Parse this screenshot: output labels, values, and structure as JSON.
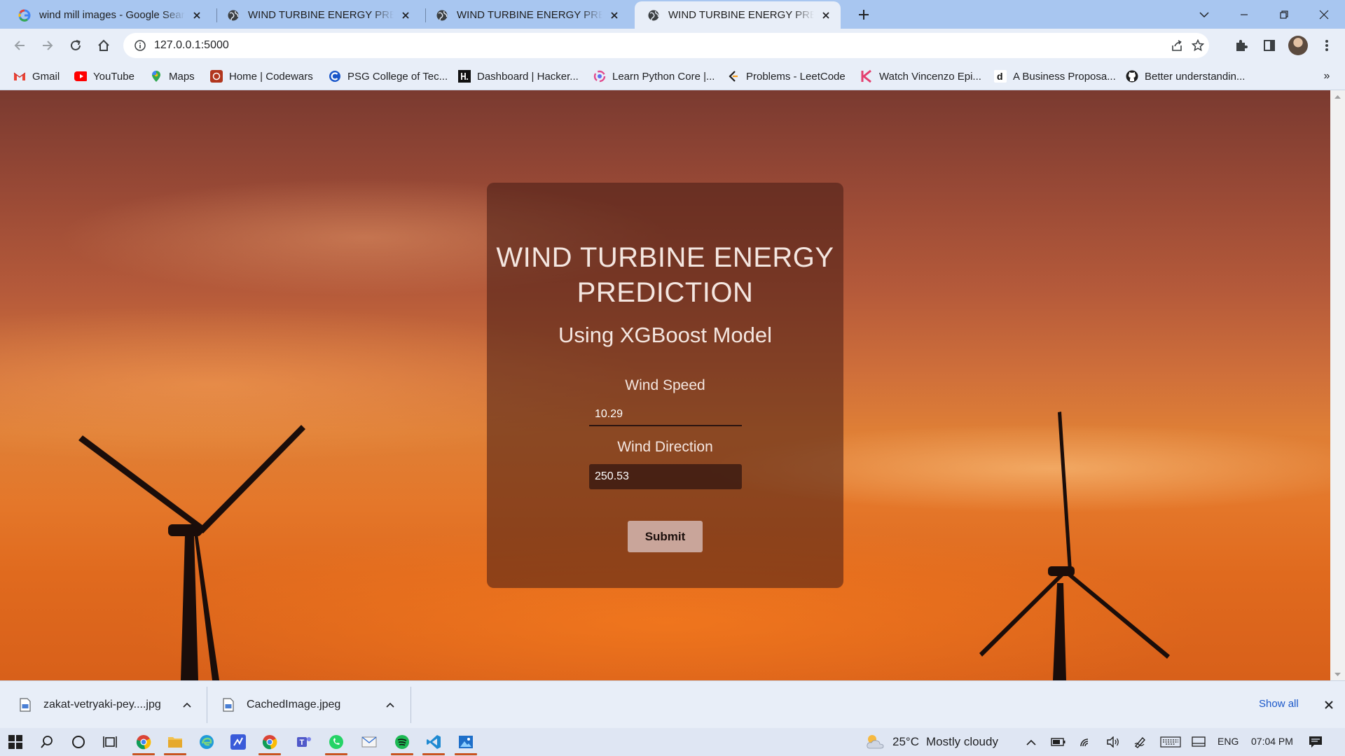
{
  "browser": {
    "tabs": [
      {
        "title": "wind mill images - Google Search",
        "favicon": "google-icon",
        "active": false
      },
      {
        "title": "WIND TURBINE ENERGY PREDICTION",
        "favicon": "globe-icon",
        "active": false
      },
      {
        "title": "WIND TURBINE ENERGY PREDICTION",
        "favicon": "globe-icon",
        "active": false
      },
      {
        "title": "WIND TURBINE ENERGY PREDICTION",
        "favicon": "globe-icon",
        "active": true
      }
    ],
    "url": "127.0.0.1:5000",
    "bookmarks": [
      {
        "label": "Gmail",
        "icon": "gmail-icon"
      },
      {
        "label": "YouTube",
        "icon": "youtube-icon"
      },
      {
        "label": "Maps",
        "icon": "maps-icon"
      },
      {
        "label": "Home | Codewars",
        "icon": "codewars-icon"
      },
      {
        "label": "PSG College of Tec...",
        "icon": "psg-icon"
      },
      {
        "label": "Dashboard | Hacker...",
        "icon": "hackerrank-icon"
      },
      {
        "label": "Learn Python Core |...",
        "icon": "python-course-icon"
      },
      {
        "label": "Problems - LeetCode",
        "icon": "leetcode-icon"
      },
      {
        "label": "Watch Vincenzo Epi...",
        "icon": "kdrama-icon"
      },
      {
        "label": "A Business Proposa...",
        "icon": "d-icon"
      },
      {
        "label": "Better understandin...",
        "icon": "github-icon"
      }
    ],
    "bookmarks_more": "»"
  },
  "page": {
    "title": "WIND TURBINE ENERGY PREDICTION",
    "subtitle": "Using XGBoost Model",
    "wind_speed": {
      "label": "Wind Speed",
      "value": "10.29"
    },
    "wind_direction": {
      "label": "Wind Direction",
      "value": "250.53"
    },
    "submit_label": "Submit"
  },
  "downloads": {
    "items": [
      {
        "name": "zakat-vetryaki-pey....jpg"
      },
      {
        "name": "CachedImage.jpeg"
      }
    ],
    "show_all": "Show all"
  },
  "taskbar": {
    "weather": {
      "temp": "25°C",
      "condition": "Mostly cloudy"
    },
    "language": "ENG",
    "time": "07:04 PM"
  },
  "colors": {
    "tab_strip": "#a8c6f0",
    "toolbar": "#e8eef8",
    "sky_top": "#7a3a30",
    "sky_bottom": "#d8601a",
    "card": "#461c14",
    "link": "#1a57c9",
    "taskbar_accent": "#c9531f"
  }
}
